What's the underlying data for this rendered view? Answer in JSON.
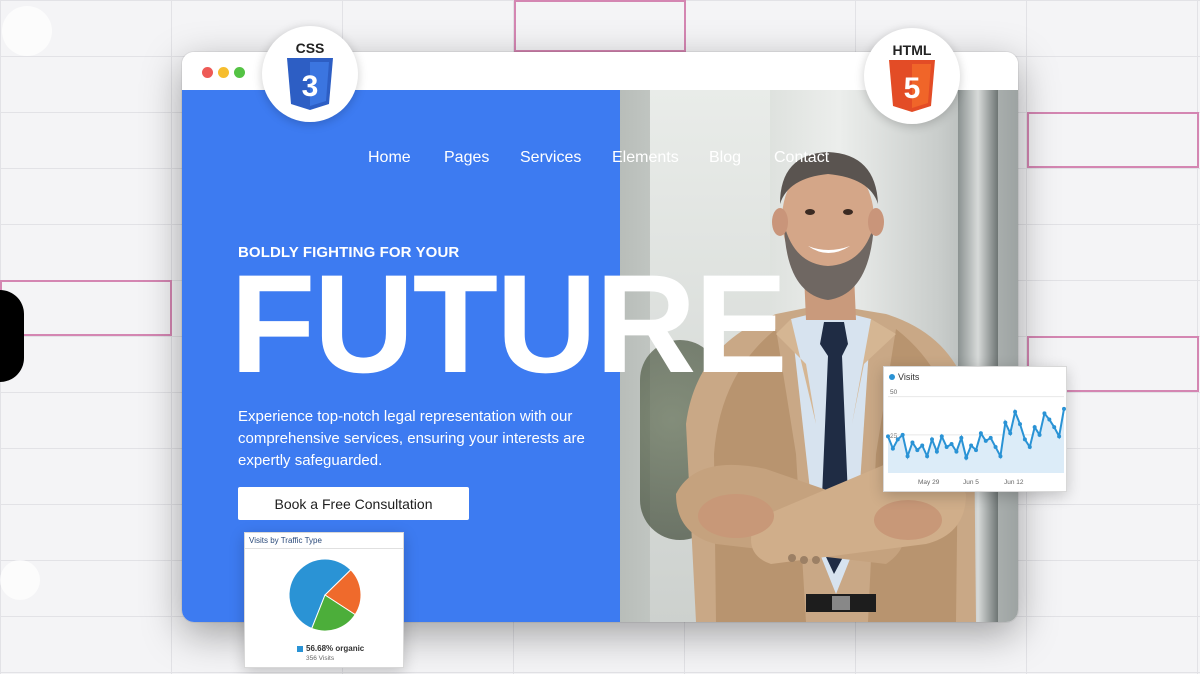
{
  "nav": [
    "Home",
    "Pages",
    "Services",
    "Elements",
    "Blog",
    "Contact"
  ],
  "hero": {
    "tagline": "BOLDLY FIGHTING FOR YOUR",
    "headline": "FUTURE",
    "description": "Experience top-notch legal representation with our comprehensive services, ensuring your interests are expertly safeguarded.",
    "cta": "Book a Free Consultation"
  },
  "badges": {
    "css": "CSS",
    "css_num": "3",
    "html": "HTML",
    "html_num": "5"
  },
  "visits_card": {
    "title": "Visits",
    "y_ticks": [
      "50",
      "25"
    ],
    "x_ticks": [
      "May 29",
      "Jun 5",
      "Jun 12"
    ],
    "values": [
      24,
      16,
      22,
      25,
      11,
      20,
      15,
      18,
      11,
      22,
      14,
      24,
      17,
      19,
      14,
      23,
      10,
      18,
      15,
      26,
      21,
      23,
      17,
      11,
      33,
      26,
      40,
      32,
      22,
      17,
      30,
      25,
      39,
      35,
      30,
      24,
      42
    ]
  },
  "traffic_card": {
    "title": "Visits by Traffic Type",
    "legend": "56.68% organic",
    "sub": "356 Visits",
    "slices": [
      56.68,
      21.5,
      21.82
    ],
    "colors": [
      "#2a93d5",
      "#ef6a2c",
      "#4cae3a"
    ]
  },
  "colors": {
    "brand_blue": "#3d7bf1",
    "line_blue": "#2a93d5"
  }
}
